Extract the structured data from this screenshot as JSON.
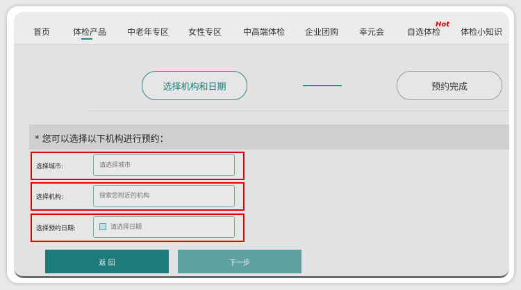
{
  "nav": {
    "items": [
      {
        "label": "首页"
      },
      {
        "label": "体检产品"
      },
      {
        "label": "中老年专区"
      },
      {
        "label": "女性专区"
      },
      {
        "label": "中高端体检"
      },
      {
        "label": "企业团购"
      },
      {
        "label": "幸元会"
      },
      {
        "label": "自选体检"
      },
      {
        "label": "体检小知识"
      }
    ],
    "hot_badge": "Hot",
    "accent_color": "#1a8a8a"
  },
  "steps": {
    "step1": "选择机构和日期",
    "step2": "预约完成"
  },
  "form": {
    "prompt": "* 您可以选择以下机构进行预约：",
    "city_label": "选择城市:",
    "city_placeholder": "请选择城市",
    "org_label": "选择机构:",
    "org_placeholder": "搜索您附近的机构",
    "date_label": "选择预约日期:",
    "date_placeholder": "请选择日期",
    "highlight_color": "#e30000"
  },
  "buttons": {
    "back": "返 回",
    "next": "下一步"
  }
}
